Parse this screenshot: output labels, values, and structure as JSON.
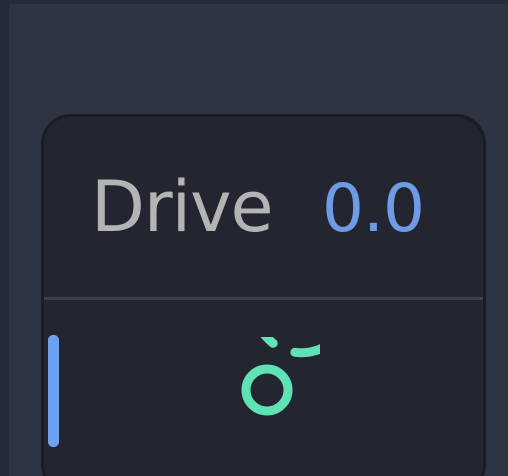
{
  "parameter": {
    "label": "Drive",
    "value": "0.0"
  },
  "level": {
    "fraction": 1.0
  },
  "knob": {
    "icon": "rotary-knob-icon",
    "color": "#5fe3b3"
  },
  "colors": {
    "label": "#b4b4b4",
    "value": "#6e9be6",
    "level": "#6ea0f0",
    "panel": "#232631",
    "background": "#2f3442"
  }
}
